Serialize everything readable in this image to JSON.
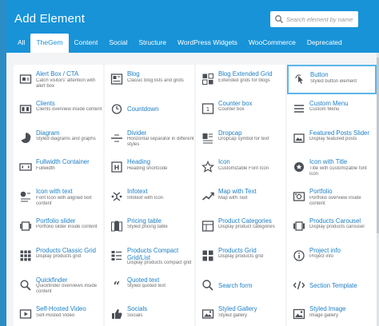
{
  "header": {
    "title": "Add Element",
    "search_placeholder": "Search element by name"
  },
  "tabs": [
    {
      "label": "All",
      "active": false
    },
    {
      "label": "TheGem",
      "active": true
    },
    {
      "label": "Content",
      "active": false
    },
    {
      "label": "Social",
      "active": false
    },
    {
      "label": "Structure",
      "active": false
    },
    {
      "label": "WordPress Widgets",
      "active": false
    },
    {
      "label": "WooCommerce",
      "active": false
    },
    {
      "label": "Deprecated",
      "active": false
    }
  ],
  "elements": [
    {
      "name": "Alert Box / CTA",
      "desc": "Catch visitors' attention with alert box",
      "icon": "alert-box-icon"
    },
    {
      "name": "Blog",
      "desc": "Classic blog lists and grids",
      "icon": "blog-icon"
    },
    {
      "name": "Blog Extended Grid",
      "desc": "Extended grids for blogs",
      "icon": "blog-grid-icon"
    },
    {
      "name": "Button",
      "desc": "Styled button element",
      "icon": "button-icon"
    },
    {
      "name": "Clients",
      "desc": "Clients overview inside content",
      "icon": "clients-icon"
    },
    {
      "name": "Countdown",
      "desc": "",
      "icon": "countdown-icon"
    },
    {
      "name": "Counter box",
      "desc": "Counter box",
      "icon": "counter-box-icon"
    },
    {
      "name": "Custom Menu",
      "desc": "Custom Menu",
      "icon": "custom-menu-icon"
    },
    {
      "name": "Diagram",
      "desc": "Styled diagrams and graphs",
      "icon": "diagram-icon"
    },
    {
      "name": "Divider",
      "desc": "Horizontal separator in different styles",
      "icon": "divider-icon"
    },
    {
      "name": "Dropcap",
      "desc": "Dropcap symbol for text",
      "icon": "dropcap-icon"
    },
    {
      "name": "Featured Posts Slider",
      "desc": "Display featured posts",
      "icon": "featured-slider-icon"
    },
    {
      "name": "Fullwidth Container",
      "desc": "Fullwidth",
      "icon": "fullwidth-container-icon"
    },
    {
      "name": "Heading",
      "desc": "Heading shortcode",
      "icon": "heading-icon"
    },
    {
      "name": "Icon",
      "desc": "Customizable Font Icon",
      "icon": "star-icon"
    },
    {
      "name": "Icon with Title",
      "desc": "Title with customizable font icon",
      "icon": "icon-with-title-icon"
    },
    {
      "name": "Icon with text",
      "desc": "Font Icon with aligned text content",
      "icon": "icon-with-text-icon"
    },
    {
      "name": "Infotext",
      "desc": "Infotext with Icon",
      "icon": "infotext-icon"
    },
    {
      "name": "Map with Text",
      "desc": "Map with Text",
      "icon": "map-icon"
    },
    {
      "name": "Portfolio",
      "desc": "Portfolio overview inside content",
      "icon": "portfolio-icon"
    },
    {
      "name": "Portfolio slider",
      "desc": "Portfolio slider inside content",
      "icon": "portfolio-slider-icon"
    },
    {
      "name": "Pricing table",
      "desc": "Styled pricing table",
      "icon": "pricing-table-icon"
    },
    {
      "name": "Product Categories",
      "desc": "Display product categories",
      "icon": "product-categories-icon"
    },
    {
      "name": "Products Carousel",
      "desc": "Display products carousel",
      "icon": "products-carousel-icon"
    },
    {
      "name": "Products Classic Grid",
      "desc": "Display products grid",
      "icon": "products-classic-grid-icon"
    },
    {
      "name": "Products Compact Grid/List",
      "desc": "Display products compact grid",
      "icon": "products-compact-grid-icon"
    },
    {
      "name": "Products Grid",
      "desc": "Display products grid",
      "icon": "products-grid-icon"
    },
    {
      "name": "Project info",
      "desc": "Project info",
      "icon": "project-info-icon"
    },
    {
      "name": "Quickfinder",
      "desc": "Quickfinder overviews inside content",
      "icon": "quickfinder-icon"
    },
    {
      "name": "Quoted text",
      "desc": "Styled quoted text",
      "icon": "quote-icon"
    },
    {
      "name": "Search form",
      "desc": "",
      "icon": "search-form-icon"
    },
    {
      "name": "Section Template",
      "desc": "",
      "icon": "section-template-icon"
    },
    {
      "name": "Self-Hosted Video",
      "desc": "Self-Hosted Video",
      "icon": "video-icon"
    },
    {
      "name": "Socials",
      "desc": "Socials",
      "icon": "socials-icon"
    },
    {
      "name": "Styled Gallery",
      "desc": "Styled gallery",
      "icon": "styled-gallery-icon"
    },
    {
      "name": "Styled Image",
      "desc": "Image gallery",
      "icon": "styled-image-icon"
    }
  ],
  "selected_element": "Button",
  "colors": {
    "header": "#1893d8",
    "name_text": "#1e7fc4",
    "selected_border": "#5bb5e8",
    "backdrop": "#2c8cc6"
  }
}
